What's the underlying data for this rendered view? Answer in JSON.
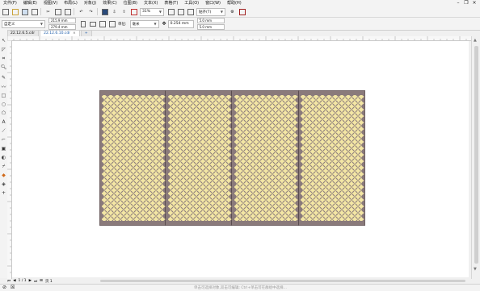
{
  "menu": {
    "items": [
      "文件(F)",
      "编辑(E)",
      "视图(V)",
      "布局(L)",
      "对象(J)",
      "效果(C)",
      "位图(B)",
      "文本(X)",
      "表格(T)",
      "工具(O)",
      "窗口(W)",
      "帮助(H)"
    ]
  },
  "toolbar": {
    "zoom": "31%",
    "snap_label": "贴齐(T)"
  },
  "propbar": {
    "paper_preset": "自定义",
    "width": "215.9 mm",
    "height": "279.4 mm",
    "units_label": "单位:",
    "units": "毫米",
    "nudge": "0.254 mm",
    "dup_x": "5.0 mm",
    "dup_y": "5.0 mm"
  },
  "tabs": [
    {
      "label": "22.12.6.5.cdr",
      "active": false
    },
    {
      "label": "22.12.6.10.cdr",
      "active": true
    }
  ],
  "pagenav": {
    "page_of": "1 / 1",
    "page_tab": "页 1"
  },
  "status": {
    "hint": "单击可选择对象,双击可编辑; Ctrl+单击可在群组中选择..."
  },
  "colors": {
    "panel_fill": "#8a7a7b",
    "dot_fill": "#f3e6a4",
    "divider": "#5a4d50"
  }
}
